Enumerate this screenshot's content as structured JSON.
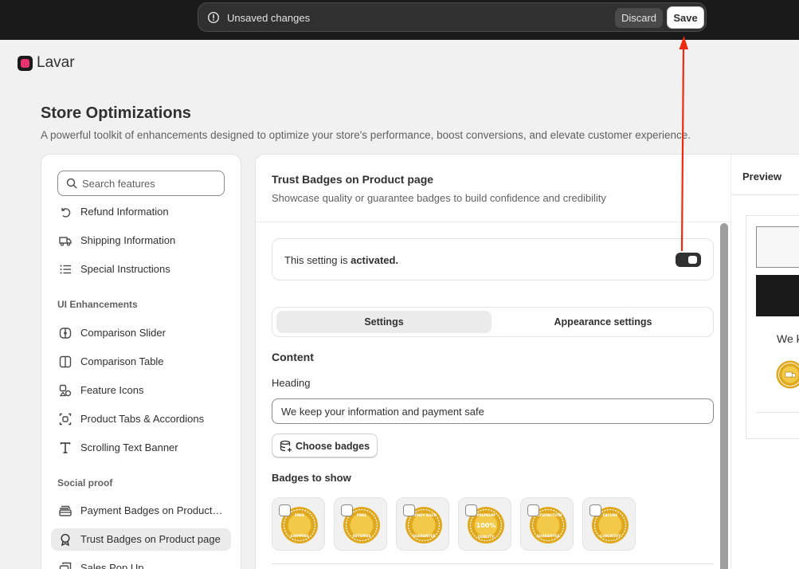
{
  "save_bar": {
    "message": "Unsaved changes",
    "discard_label": "Discard",
    "save_label": "Save"
  },
  "app": {
    "name": "Lavar"
  },
  "page": {
    "title": "Store Optimizations",
    "subtitle": "A powerful toolkit of enhancements designed to optimize your store's performance, boost conversions, and elevate customer experience."
  },
  "sidebar": {
    "search_placeholder": "Search features",
    "items_top": [
      {
        "label": "Refund Information",
        "icon": "refund-icon"
      },
      {
        "label": "Shipping Information",
        "icon": "truck-icon"
      },
      {
        "label": "Special Instructions",
        "icon": "list-icon"
      }
    ],
    "section_ui": "UI Enhancements",
    "items_ui": [
      {
        "label": "Comparison Slider",
        "icon": "compare-slider-icon"
      },
      {
        "label": "Comparison Table",
        "icon": "columns-icon"
      },
      {
        "label": "Feature Icons",
        "icon": "shapes-icon"
      },
      {
        "label": "Product Tabs & Accordions",
        "icon": "tabs-icon"
      },
      {
        "label": "Scrolling Text Banner",
        "icon": "text-icon"
      }
    ],
    "section_social": "Social proof",
    "items_social": [
      {
        "label": "Payment Badges on Product page",
        "icon": "payment-icon"
      },
      {
        "label": "Trust Badges on Product page",
        "icon": "badge-icon",
        "active": true
      },
      {
        "label": "Sales Pop Up",
        "icon": "popup-icon"
      }
    ]
  },
  "card": {
    "title": "Trust Badges on Product page",
    "subtitle": "Showcase quality or guarantee badges to build confidence and credibility",
    "status_prefix": "This setting is ",
    "status_value": "activated.",
    "tabs": [
      "Settings",
      "Appearance settings"
    ],
    "content_heading": "Content",
    "heading_label": "Heading",
    "heading_value": "We keep your information and payment safe",
    "choose_badges_label": "Choose badges",
    "badges_heading": "Badges to show",
    "badges": [
      {
        "name": "free-shipping-badge",
        "lines": [
          "FREE",
          "SHIPPING"
        ]
      },
      {
        "name": "free-returns-badge",
        "lines": [
          "FREE",
          "RETURNS"
        ]
      },
      {
        "name": "money-back-badge",
        "lines": [
          "MONEY BACK",
          "GUARANTEE"
        ]
      },
      {
        "name": "premium-quality-badge",
        "lines": [
          "PREMIUM",
          "100%",
          "QUALITY"
        ]
      },
      {
        "name": "satisfaction-badge",
        "lines": [
          "SATISFACTION",
          "GUARANTEE"
        ]
      },
      {
        "name": "secure-checkout-badge",
        "lines": [
          "SECURE",
          "CHECKOUT"
        ]
      }
    ]
  },
  "preview": {
    "tab_label": "Preview",
    "heading_visible": "We k"
  },
  "colors": {
    "topbar": "#1a1a1a",
    "badge_gold": "#e0a81d",
    "annotation": "#ee2b10",
    "toggle_on": "#303030"
  }
}
